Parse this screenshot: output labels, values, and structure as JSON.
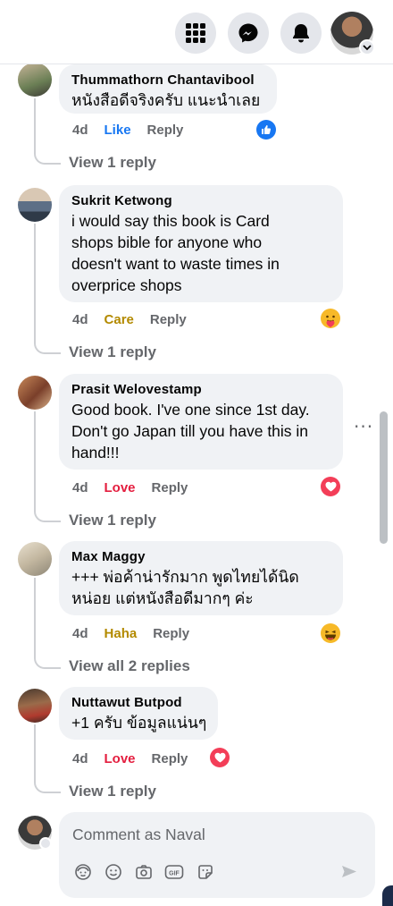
{
  "topbar": {
    "icons": [
      "menu-grid-icon",
      "messenger-icon",
      "notifications-bell-icon",
      "profile-avatar"
    ]
  },
  "comments": [
    {
      "author": "Thummathorn Chantavibool",
      "lines": [
        "หนังสือดีจริงครับ แนะนำเลย"
      ],
      "time": "4d",
      "reaction_label": "Like",
      "reaction_color": "#1877f2",
      "reply_label": "Reply",
      "reaction_icon": "like-icon",
      "view_replies": "View 1 reply"
    },
    {
      "author": "Sukrit Ketwong",
      "lines": [
        "i would say this book is Card",
        "shops bible for anyone who",
        "doesn't want to waste times in",
        "overprice shops"
      ],
      "time": "4d",
      "reaction_label": "Care",
      "reaction_color": "#b38a00",
      "reply_label": "Reply",
      "reaction_icon": "care-icon",
      "view_replies": "View 1 reply"
    },
    {
      "author": "Prasit Welovestamp",
      "lines": [
        "Good book. I've one since 1st day.",
        "Don't go Japan till you have this in",
        "hand!!!"
      ],
      "time": "4d",
      "reaction_label": "Love",
      "reaction_color": "#e41e3f",
      "reply_label": "Reply",
      "reaction_icon": "love-icon",
      "view_replies": "View 1 reply"
    },
    {
      "author": "Max Maggy",
      "lines": [
        "+++ พ่อค้าน่ารักมาก พูดไทยได้นิด",
        "หน่อย แต่หนังสือดีมากๆ ค่ะ"
      ],
      "time": "4d",
      "reaction_label": "Haha",
      "reaction_color": "#b38a00",
      "reply_label": "Reply",
      "reaction_icon": "haha-icon",
      "view_replies": "View all 2 replies"
    },
    {
      "author": "Nuttawut Butpod",
      "lines": [
        "+1 ครับ ข้อมูลแน่นๆ"
      ],
      "time": "4d",
      "reaction_label": "Love",
      "reaction_color": "#e41e3f",
      "reply_label": "Reply",
      "reaction_icon": "love-icon",
      "view_replies": "View 1 reply"
    }
  ],
  "composer": {
    "placeholder": "Comment as Naval",
    "tools": [
      "avatar-sticker-icon",
      "emoji-icon",
      "camera-icon",
      "gif-icon",
      "sticker-icon"
    ],
    "send_icon": "send-icon"
  },
  "colors": {
    "bubble_bg": "#f0f2f5",
    "secondary_text": "#65676b",
    "like_blue": "#1877f2",
    "love_red": "#e41e3f"
  }
}
